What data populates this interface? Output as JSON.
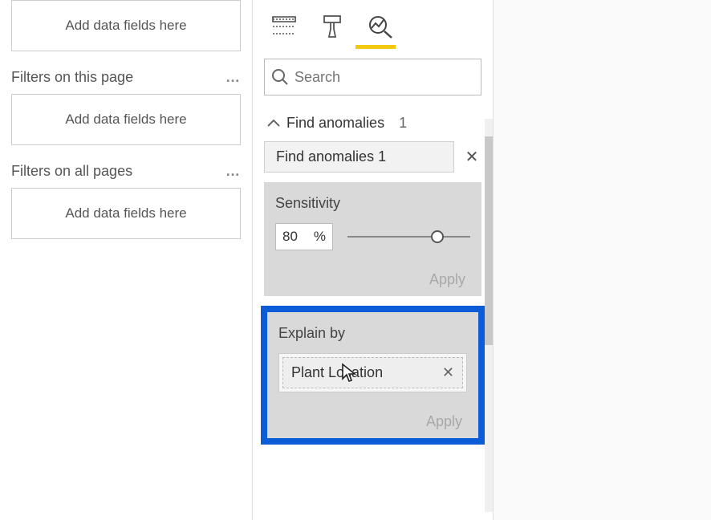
{
  "filters": {
    "visual_dropzone": "Add data fields here",
    "page_label": "Filters on this page",
    "page_dropzone": "Add data fields here",
    "all_label": "Filters on all pages",
    "all_dropzone": "Add data fields here"
  },
  "viz": {
    "search_placeholder": "Search",
    "expander_label": "Find anomalies",
    "expander_count": "1",
    "chip_label": "Find anomalies 1",
    "sensitivity_label": "Sensitivity",
    "sensitivity_value": "80",
    "sensitivity_unit": "%",
    "apply_label": "Apply",
    "explain_label": "Explain by",
    "explain_field": "Plant Location",
    "explain_apply": "Apply"
  }
}
